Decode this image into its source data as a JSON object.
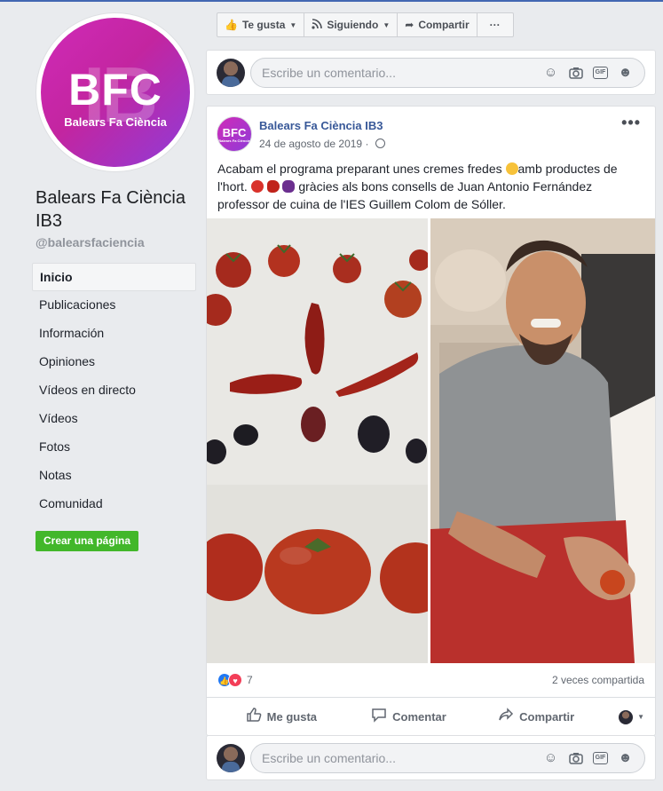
{
  "page": {
    "logo_text": "BFC",
    "logo_watermark": "IB",
    "logo_subtitle": "Balears Fa Ciència",
    "name": "Balears Fa Ciència IB3",
    "handle": "@balearsfaciencia",
    "brand_color": "#c325a0"
  },
  "nav": {
    "items": [
      {
        "label": "Inicio"
      },
      {
        "label": "Publicaciones"
      },
      {
        "label": "Información"
      },
      {
        "label": "Opiniones"
      },
      {
        "label": "Vídeos en directo"
      },
      {
        "label": "Vídeos"
      },
      {
        "label": "Fotos"
      },
      {
        "label": "Notas"
      },
      {
        "label": "Comunidad"
      }
    ],
    "create_page": "Crear una página"
  },
  "toolbar": {
    "like": "Te gusta",
    "following": "Siguiendo",
    "share": "Compartir",
    "more": "···"
  },
  "comment": {
    "placeholder": "Escribe un comentario...",
    "icons": [
      "emoji-icon",
      "camera-icon",
      "gif-icon",
      "sticker-icon"
    ]
  },
  "post": {
    "author": "Balears Fa Ciència IB3",
    "date": "24 de agosto de 2019 · ",
    "text1": "Acabam el programa preparant unes cremes fredes ",
    "text2": "amb productes de l'hort. ",
    "text3": " gràcies als bons consells de Juan Antonio Fernández professor de cuina de l'IES Guillem Colom de Sóller.",
    "reactions_count": "7",
    "shares": "2 veces compartida",
    "actions": {
      "like": "Me gusta",
      "comment": "Comentar",
      "share": "Compartir"
    }
  }
}
